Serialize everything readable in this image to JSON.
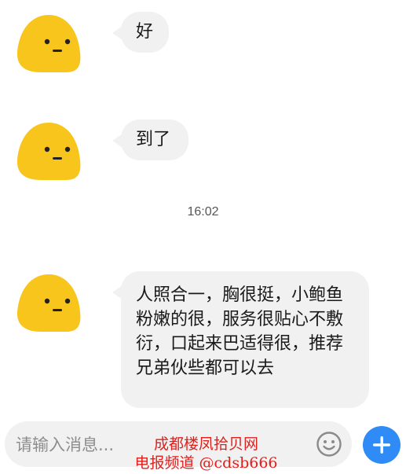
{
  "chat": {
    "messages": [
      {
        "text": "好"
      },
      {
        "text": "到了"
      },
      {
        "text": "人照合一，胸很挺，小鲍鱼粉嫩的很，服务很贴心不敷衍，口起来巴适得很，推荐兄弟伙些都可以去"
      }
    ],
    "timestamp": "16:02"
  },
  "composer": {
    "placeholder": "请输入消息...",
    "emoji_icon": "smiley-face-icon",
    "add_icon": "plus-icon"
  },
  "overlay": {
    "line1": "成都楼凤拾贝网",
    "line2": "电报频道 @cdsb666"
  },
  "colors": {
    "avatar_yellow": "#f8c51c",
    "bubble_bg": "#f1f1f1",
    "accent_blue": "#2f8bf5",
    "watermark_red": "#e0201c"
  }
}
